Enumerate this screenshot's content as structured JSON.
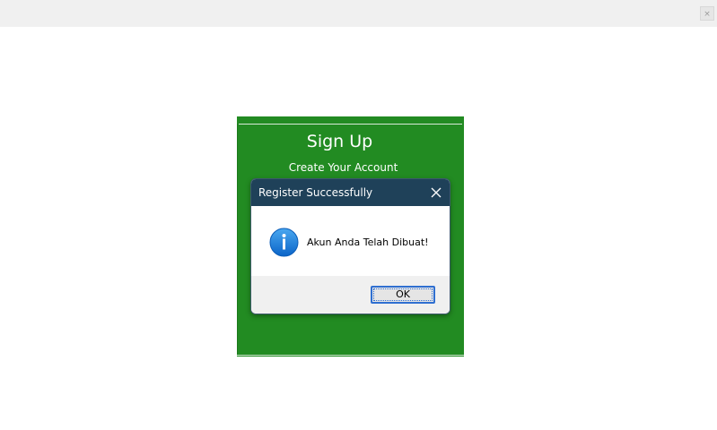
{
  "window": {
    "close_glyph": "×"
  },
  "signup": {
    "title": "Sign Up",
    "subtitle": "Create Your Account",
    "background_color": "#228b22"
  },
  "dialog": {
    "title": "Register Successfully",
    "message": "Akun Anda Telah Dibuat!",
    "icon": "info-icon",
    "ok_label": "OK",
    "header_color": "#1f4159",
    "icon_color": "#1e88e5"
  }
}
